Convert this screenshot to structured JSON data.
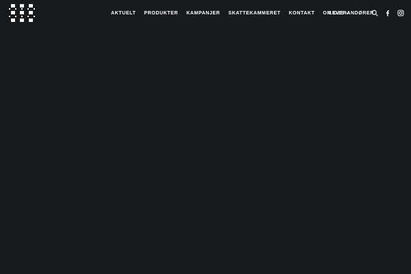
{
  "nav": {
    "items": [
      {
        "label": "AKTUELT"
      },
      {
        "label": "PRODUKTER"
      },
      {
        "label": "KAMPANJER"
      },
      {
        "label": "SKATTEKAMMERET"
      },
      {
        "label": "KONTAKT"
      },
      {
        "label": "OM OSS"
      }
    ],
    "suppliers_label": "LEVERANDØRER"
  },
  "icons": {
    "logo": "grid-logo-icon",
    "search": "search-icon",
    "facebook": "facebook-icon",
    "instagram": "instagram-icon",
    "dropdown": "chevron-down-icon"
  },
  "colors": {
    "background": "#181b1e",
    "text": "#ffffff"
  }
}
